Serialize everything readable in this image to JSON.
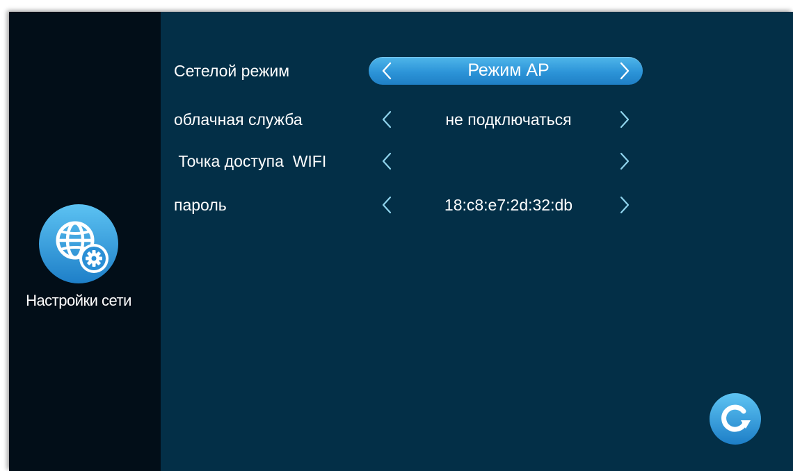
{
  "sidebar": {
    "icon": "globe-gear-icon",
    "label": "Настройки сети"
  },
  "settings": [
    {
      "label": "Сетелой режим",
      "value": "Режим AP",
      "selected": true
    },
    {
      "label": "облачная служба",
      "value": "не подключаться",
      "selected": false
    },
    {
      "label": " Точка доступа  WIFI",
      "value": "",
      "selected": false
    },
    {
      "label": "пароль",
      "value": "18:c8:e7:2d:32:db",
      "selected": false
    }
  ],
  "icons": {
    "prev": "chevron-left-icon",
    "next": "chevron-right-icon",
    "refresh": "refresh-icon"
  },
  "colors": {
    "background": "#032f47",
    "sidebar": "#020e18",
    "accent": "#2c94d8",
    "arrow": "#8fd3ec"
  }
}
